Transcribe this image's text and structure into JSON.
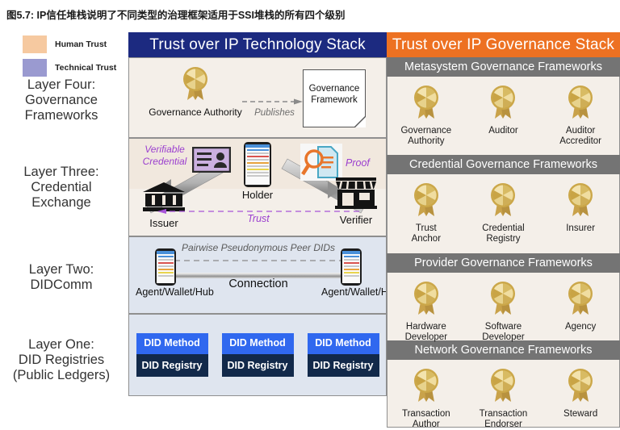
{
  "figure": {
    "title": "图5.7: IP信任堆栈说明了不同类型的治理框架适用于SSI堆栈的所有四个级别"
  },
  "legend": {
    "items": [
      {
        "label": "Human Trust",
        "color": "#f6c9a0"
      },
      {
        "label": "Technical Trust",
        "color": "#9a9ad0"
      }
    ]
  },
  "layer_labels": [
    {
      "lines": [
        "Layer Four:",
        "Governance",
        "Frameworks"
      ]
    },
    {
      "lines": [
        "Layer Three:",
        "Credential",
        "Exchange"
      ]
    },
    {
      "lines": [
        "Layer Two:",
        "DIDComm"
      ]
    },
    {
      "lines": [
        "Layer One:",
        "DID Registries",
        "(Public Ledgers)"
      ]
    }
  ],
  "technology_stack": {
    "header": "Trust over IP Technology Stack",
    "header_color": "#1c2a80",
    "layer_four": {
      "governance_authority": {
        "lines": [
          "Governance",
          "Authority"
        ]
      },
      "publishes_label": "Publishes",
      "governance_framework": {
        "lines": [
          "Governance",
          "Framework"
        ]
      }
    },
    "layer_three": {
      "verifiable_credential_label": {
        "lines": [
          "Verifiable",
          "Credential"
        ]
      },
      "proof_label": "Proof",
      "issuer_label": "Issuer",
      "holder_label": "Holder",
      "verifier_label": "Verifier",
      "trust_label": "Trust"
    },
    "layer_two": {
      "pairwise_label": "Pairwise Pseudonymous Peer DIDs",
      "connection_label": "Connection",
      "agent_left_label": "Agent/Wallet/Hub",
      "agent_right_label": "Agent/Wallet/Hub"
    },
    "layer_one": {
      "cards": [
        {
          "method": [
            "DID",
            "Method"
          ],
          "registry": "DID Registry"
        },
        {
          "method": [
            "DID",
            "Method"
          ],
          "registry": "DID Registry"
        },
        {
          "method": [
            "DID",
            "Method"
          ],
          "registry": "DID Registry"
        }
      ],
      "method_color": "#3068ef",
      "registry_color": "#12294a"
    }
  },
  "governance_stack": {
    "header": "Trust over IP Governance Stack",
    "header_color": "#ed7122",
    "band_color": "#747474",
    "bands": [
      {
        "title": "Metasystem Governance Frameworks",
        "roles": [
          {
            "lines": [
              "Governance",
              "Authority"
            ]
          },
          {
            "lines": [
              "Auditor"
            ]
          },
          {
            "lines": [
              "Auditor",
              "Accreditor"
            ]
          }
        ]
      },
      {
        "title": "Credential Governance Frameworks",
        "roles": [
          {
            "lines": [
              "Trust",
              "Anchor"
            ]
          },
          {
            "lines": [
              "Credential",
              "Registry"
            ]
          },
          {
            "lines": [
              "Insurer"
            ]
          }
        ]
      },
      {
        "title": "Provider Governance Frameworks",
        "roles": [
          {
            "lines": [
              "Hardware",
              "Developer"
            ]
          },
          {
            "lines": [
              "Software",
              "Developer"
            ]
          },
          {
            "lines": [
              "Agency"
            ]
          }
        ]
      },
      {
        "title": "Network Governance Frameworks",
        "roles": [
          {
            "lines": [
              "Transaction",
              "Author"
            ]
          },
          {
            "lines": [
              "Transaction",
              "Endorser"
            ]
          },
          {
            "lines": [
              "Steward"
            ]
          }
        ]
      }
    ]
  }
}
